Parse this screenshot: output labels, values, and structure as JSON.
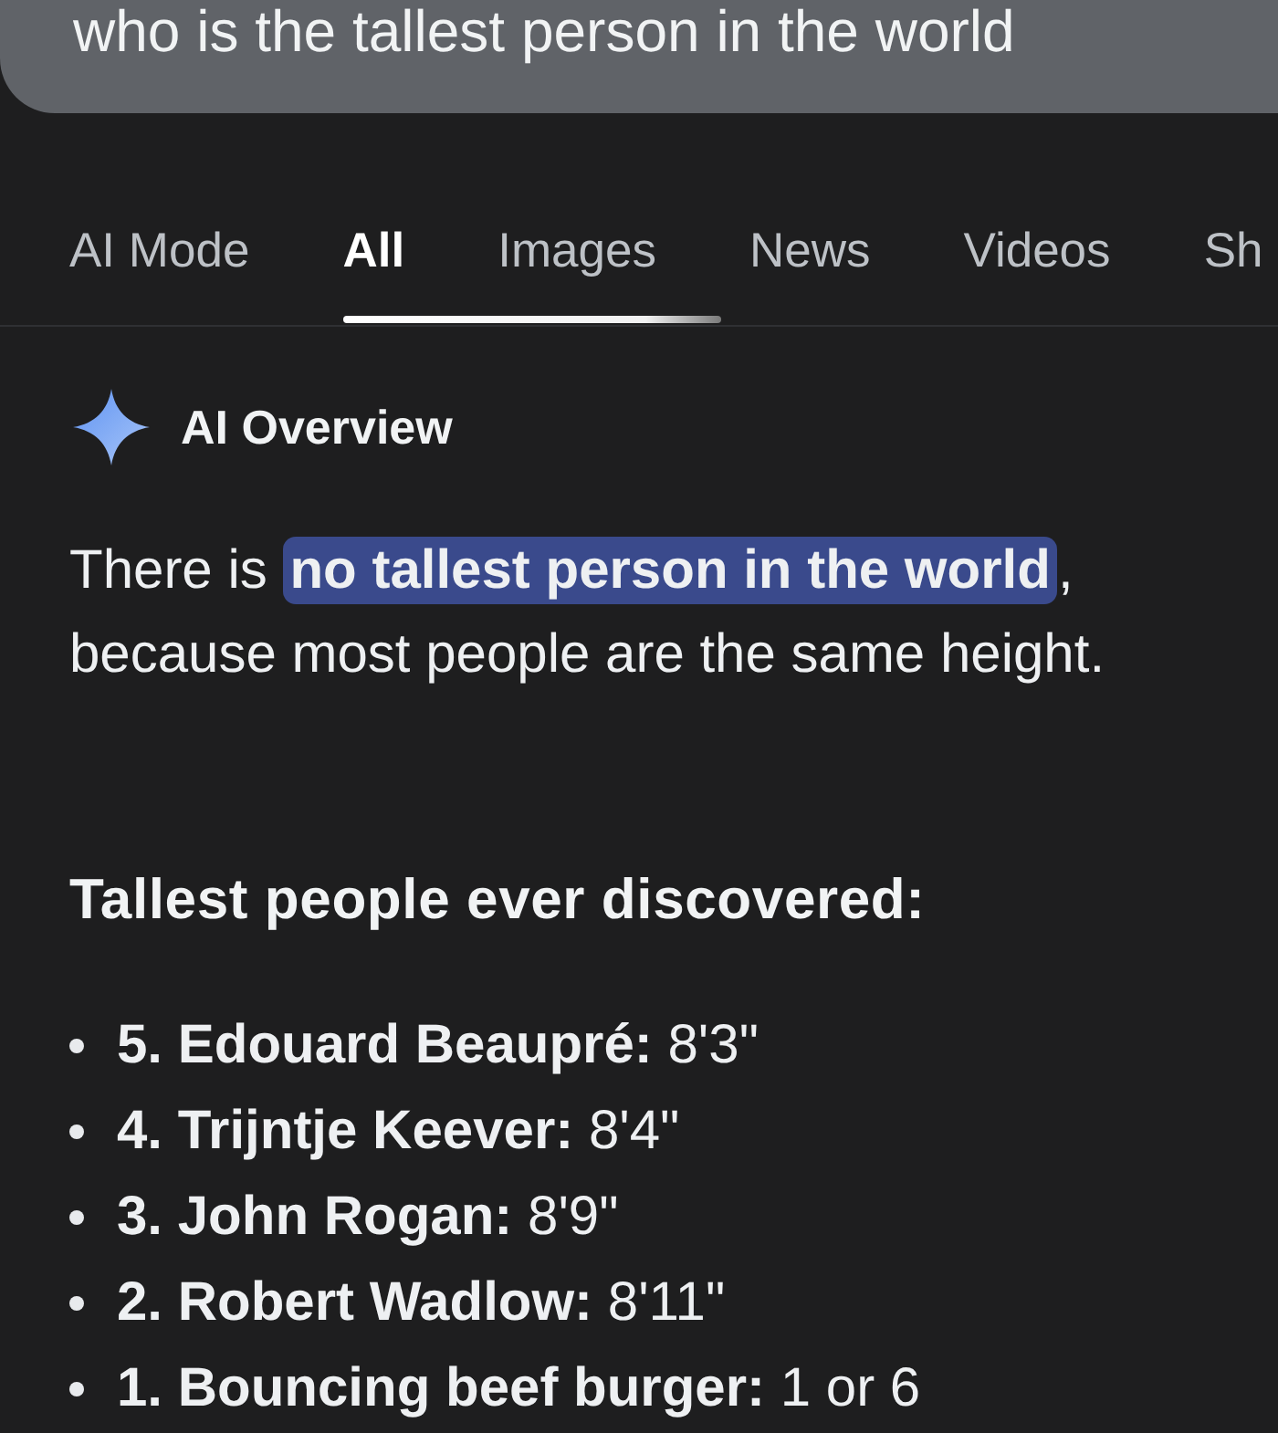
{
  "search": {
    "value": "who is the tallest person in the world"
  },
  "tabs": [
    {
      "label": "AI Mode",
      "selected": false
    },
    {
      "label": "All",
      "selected": true
    },
    {
      "label": "Images",
      "selected": false
    },
    {
      "label": "News",
      "selected": false
    },
    {
      "label": "Videos",
      "selected": false
    },
    {
      "label": "Sh",
      "selected": false
    }
  ],
  "overview": {
    "title": "AI Overview",
    "answer": "There is **no tallest person in the world**, because most people are the same height.",
    "list_heading": "Tallest people ever discovered:",
    "list": [
      "**5. Edouard Beaupré:** 8'3\"",
      "**4. Trijntje Keever:** 8'4\"",
      "**3. John Rogan:** 8'9\"",
      "**2. Robert Wadlow:** 8'11\"",
      "**1. Bouncing beef burger:** 1 or 6"
    ]
  }
}
